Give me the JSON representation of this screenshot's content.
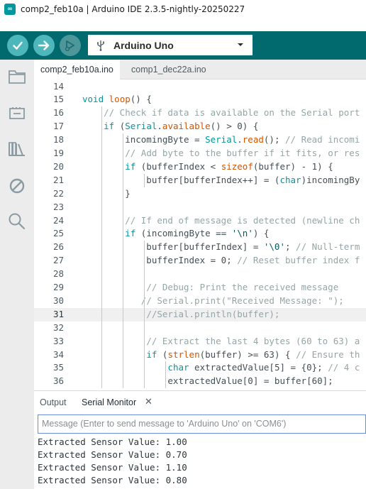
{
  "window": {
    "title": "comp2_feb10a | Arduino IDE 2.3.5-nightly-20250227",
    "logo_text": "∞"
  },
  "toolbar": {
    "verify_icon": "checkmark-icon",
    "upload_icon": "arrow-right-icon",
    "debug_icon": "debug-icon",
    "board": "Arduino Uno",
    "colors": {
      "toolbar_bg": "#006a6e",
      "button_active": "#4db7bb",
      "button_disabled": "#4d9699"
    }
  },
  "sidebar": {
    "items": [
      "folder-icon",
      "board-icon",
      "library-icon",
      "debug-off-icon",
      "search-icon"
    ]
  },
  "tabs": [
    {
      "label": "comp2_feb10a.ino",
      "active": true
    },
    {
      "label": "comp1_dec22a.ino",
      "active": false
    }
  ],
  "editor": {
    "current_line": 31,
    "lines": [
      {
        "n": "14",
        "text": ""
      },
      {
        "n": "15",
        "text": "void loop() {"
      },
      {
        "n": "16",
        "text": "    // Check if data is available on the Serial port"
      },
      {
        "n": "17",
        "text": "    if (Serial.available() > 0) {"
      },
      {
        "n": "18",
        "text": "        incomingByte = Serial.read(); // Read incomi"
      },
      {
        "n": "19",
        "text": "        // Add byte to the buffer if it fits, or res"
      },
      {
        "n": "20",
        "text": "        if (bufferIndex < sizeof(buffer) - 1) {"
      },
      {
        "n": "21",
        "text": "            buffer[bufferIndex++] = (char)incomingBy"
      },
      {
        "n": "22",
        "text": "        }"
      },
      {
        "n": "23",
        "text": ""
      },
      {
        "n": "24",
        "text": "        // If end of message is detected (newline ch"
      },
      {
        "n": "25",
        "text": "        if (incomingByte == '\\n') {"
      },
      {
        "n": "26",
        "text": "            buffer[bufferIndex] = '\\0'; // Null-term"
      },
      {
        "n": "27",
        "text": "            bufferIndex = 0; // Reset buffer index f"
      },
      {
        "n": "28",
        "text": ""
      },
      {
        "n": "29",
        "text": "            // Debug: Print the received message"
      },
      {
        "n": "30",
        "text": "           // Serial.print(\"Received Message: \");"
      },
      {
        "n": "31",
        "text": "            //Serial.println(buffer);"
      },
      {
        "n": "32",
        "text": ""
      },
      {
        "n": "33",
        "text": "            // Extract the last 4 bytes (60 to 63) a"
      },
      {
        "n": "34",
        "text": "            if (strlen(buffer) >= 63) { // Ensure th"
      },
      {
        "n": "35",
        "text": "                char extractedValue[5] = {0}; // 4 c"
      },
      {
        "n": "36",
        "text": "                extractedValue[0] = buffer[60];"
      }
    ]
  },
  "panel": {
    "tabs": [
      {
        "label": "Output",
        "active": false
      },
      {
        "label": "Serial Monitor",
        "active": true
      }
    ],
    "close_glyph": "✕",
    "input_placeholder": "Message (Enter to send message to 'Arduino Uno' on 'COM6')",
    "output_lines": [
      "Extracted Sensor Value: 1.00",
      "Extracted Sensor Value: 0.70",
      "Extracted Sensor Value: 1.10",
      "Extracted Sensor Value: 0.80"
    ]
  }
}
